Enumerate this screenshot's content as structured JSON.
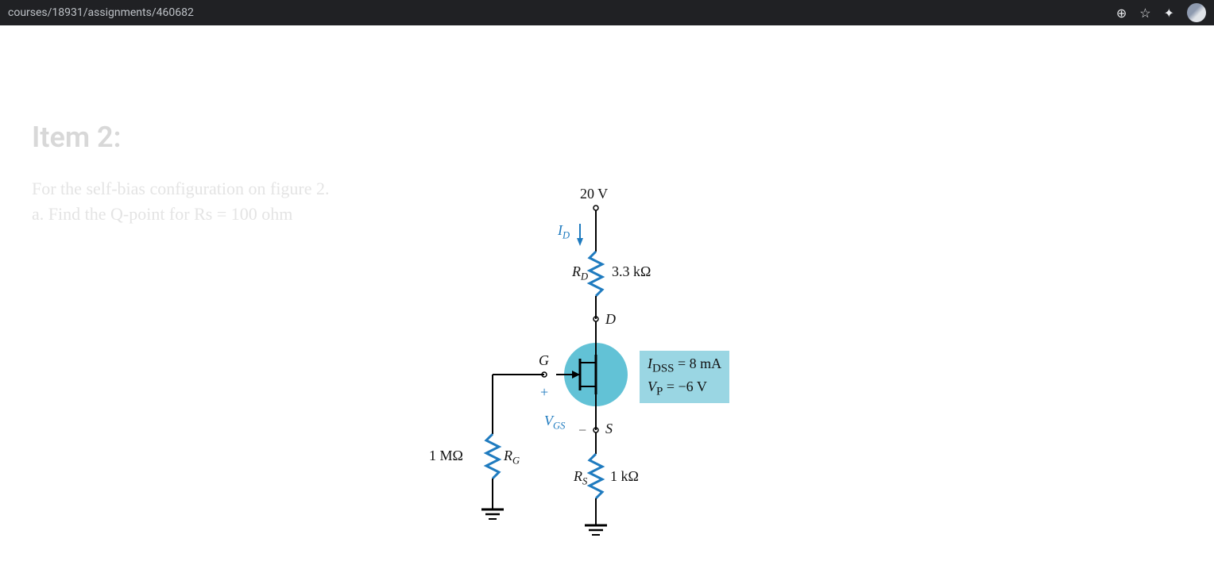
{
  "topbar": {
    "url_path": "courses/18931/assignments/460682"
  },
  "content": {
    "title": "Item 2:",
    "line1": "For the self-bias configuration on figure 2.",
    "line2": "a. Find the Q-point for Rs = 100 ohm"
  },
  "circuit": {
    "v_supply": "20 V",
    "id_label": "I",
    "id_sub": "D",
    "rd_name": "R",
    "rd_sub": "D",
    "rd_value": "3.3 kΩ",
    "node_d": "D",
    "node_g": "G",
    "node_s": "S",
    "plus": "+",
    "minus": "−",
    "vgs_name": "V",
    "vgs_sub": "GS",
    "rg_name": "R",
    "rg_sub": "G",
    "rg_value": "1 MΩ",
    "rs_name": "R",
    "rs_sub": "S",
    "rs_value": "1 kΩ",
    "idss_line": "I<sub>DSS</sub> = 8 mA",
    "vp_line": "V<sub>P</sub> = −6 V",
    "idss_text1": "I",
    "idss_sub": "DSS",
    "idss_text2": " = 8 mA",
    "vp_text1": "V",
    "vp_sub": "P",
    "vp_text2": " = −6 V"
  }
}
